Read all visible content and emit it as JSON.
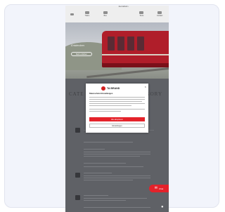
{
  "nav": {
    "items": [
      {
        "label": "",
        "icon": "home-icon"
      },
      {
        "label": "Trains",
        "icon": "train-icon"
      },
      {
        "label": "Bus",
        "icon": "bus-icon"
      },
      {
        "label": "",
        "icon": "logo"
      },
      {
        "label": "Tours",
        "icon": "ticket-icon"
      },
      {
        "label": "Contact",
        "icon": "phone-icon"
      }
    ],
    "logo_text": "Zentralbahn"
  },
  "hero": {
    "caption": "Entdecken",
    "button_label": "Mehr erfahren"
  },
  "content": {
    "heading_left": "CATE",
    "heading_right": "TEGORY"
  },
  "consent_modal": {
    "brand": "TA BRAND",
    "close_label": "×",
    "title": "Datenschutz-Einstellungen",
    "accept_label": "Alle akzeptieren",
    "settings_label": "Einstellungen"
  },
  "chat": {
    "label": "Chat",
    "icon": "chat-icon"
  },
  "colors": {
    "accent": "#e4222a",
    "train": "#b01e2a",
    "overlay": "#5f6166"
  }
}
